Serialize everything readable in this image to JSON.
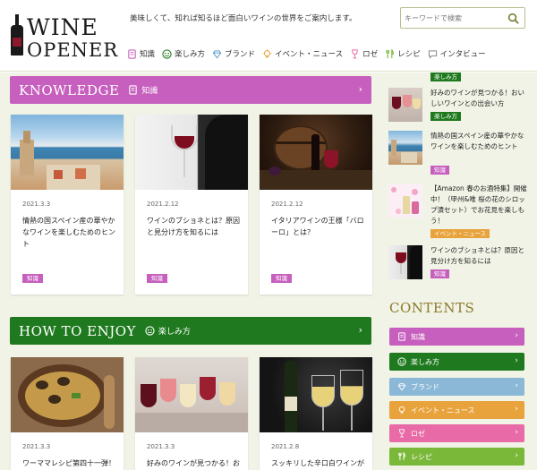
{
  "header": {
    "logo_line1": "WINE",
    "logo_line2": "OPENER",
    "tagline": "美味しくて、知れば知るほど面白いワインの世界をご案内します。",
    "search_placeholder": "キーワードで検索"
  },
  "nav": [
    {
      "label": "知識",
      "icon": "book-icon"
    },
    {
      "label": "楽しみ方",
      "icon": "smile-icon"
    },
    {
      "label": "ブランド",
      "icon": "diamond-icon"
    },
    {
      "label": "イベント・ニュース",
      "icon": "lightbulb-icon"
    },
    {
      "label": "ロゼ",
      "icon": "glass-icon"
    },
    {
      "label": "レシピ",
      "icon": "fork-knife-icon"
    },
    {
      "label": "インタビュー",
      "icon": "chat-icon"
    }
  ],
  "sections": {
    "knowledge": {
      "title": "KNOWLEDGE",
      "sub": "知識"
    },
    "enjoy": {
      "title": "HOW TO ENJOY",
      "sub": "楽しみ方"
    }
  },
  "knowledge_cards": [
    {
      "date": "2021.3.3",
      "title": "情熱の国スペイン産の華やかなワインを楽しむためのヒント",
      "tag": "知識"
    },
    {
      "date": "2021.2.12",
      "title": "ワインのブショネとは？原因と見分け方を知るには",
      "tag": "知識"
    },
    {
      "date": "2021.2.12",
      "title": "イタリアワインの王様「バローロ」とは？",
      "tag": "知識"
    }
  ],
  "enjoy_cards": [
    {
      "date": "2021.3.3",
      "title": "ワーママレシピ第四十一弾！"
    },
    {
      "date": "2021.3.3",
      "title": "好みのワインが見つかる！お"
    },
    {
      "date": "2021.2.8",
      "title": "スッキリした辛口白ワインが"
    }
  ],
  "sidebar": {
    "top_tag": "楽しみ方",
    "items": [
      {
        "text": "好みのワインが見つかる！おいしいワインとの出会い方",
        "tag": "楽しみ方",
        "tag_color": "#1f7a1f"
      },
      {
        "text": "情熱の国スペイン産の華やかなワインを楽しむためのヒント",
        "tag": "知識",
        "tag_color": "#c65fbd"
      },
      {
        "text": "【Amazon 春のお酒特集】開催中！（甲州&唯 桜の花のシロップ漬セット）でお花見を楽しもう！",
        "tag": "イベント・ニュース",
        "tag_color": "#e8a33d"
      },
      {
        "text": "ワインのブショネとは？原因と見分け方を知るには",
        "tag": "知識",
        "tag_color": "#c65fbd"
      }
    ],
    "contents_heading": "CONTENTS",
    "categories": [
      {
        "label": "知識",
        "color": "#c65fbd",
        "icon": "book-icon"
      },
      {
        "label": "楽しみ方",
        "color": "#1f7a1f",
        "icon": "smile-icon"
      },
      {
        "label": "ブランド",
        "color": "#8bb8d6",
        "icon": "diamond-icon"
      },
      {
        "label": "イベント・ニュース",
        "color": "#e8a33d",
        "icon": "lightbulb-icon"
      },
      {
        "label": "ロゼ",
        "color": "#e86aa6",
        "icon": "glass-icon"
      },
      {
        "label": "レシピ",
        "color": "#7ab83a",
        "icon": "fork-knife-icon"
      }
    ]
  },
  "chevron": "›"
}
